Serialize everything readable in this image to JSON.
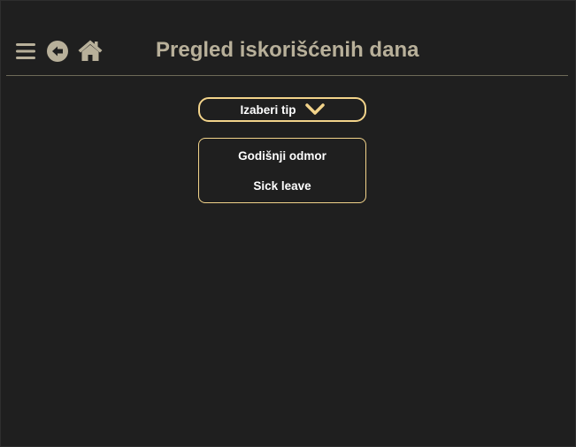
{
  "header": {
    "title": "Pregled iskorišćenih dana",
    "icons": [
      "menu-icon",
      "back-arrow-icon",
      "home-icon"
    ]
  },
  "filter": {
    "select_label": "Izaberi tip",
    "options": [
      "Godišnji odmor",
      "Sick leave"
    ]
  },
  "colors": {
    "background": "#1f1f1f",
    "accent": "#f2d38a",
    "muted": "#b8b09a",
    "text": "#ffffff"
  }
}
